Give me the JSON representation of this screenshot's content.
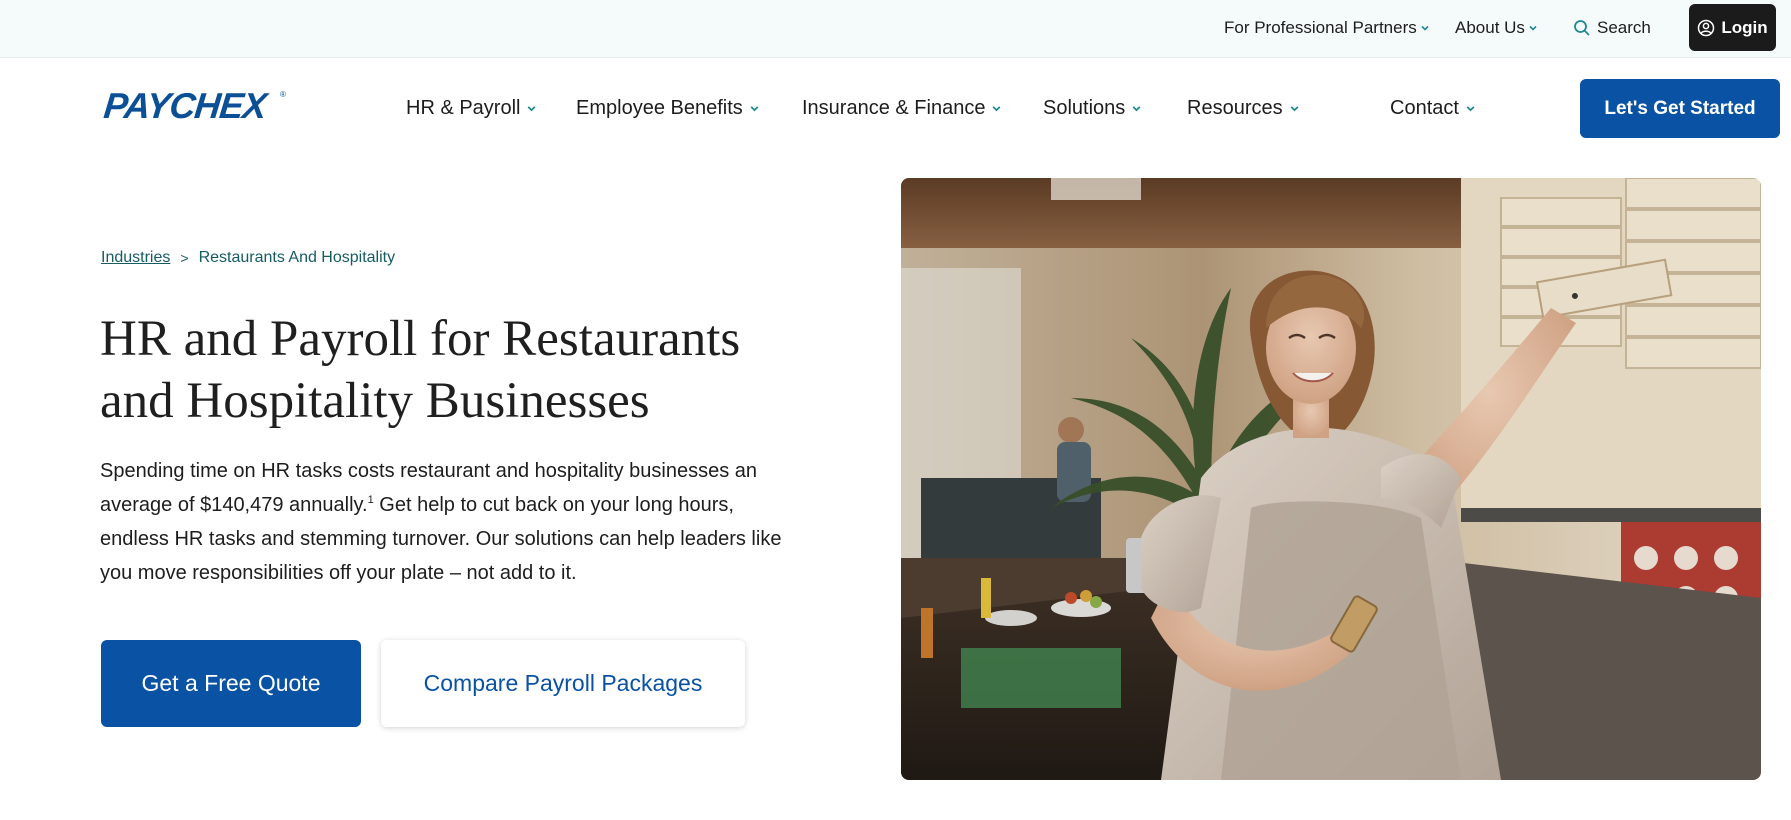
{
  "utility_bar": {
    "partners_label": "For Professional Partners",
    "about_label": "About Us",
    "search_label": "Search",
    "login_label": "Login"
  },
  "brand": {
    "logo_text": "PAYCHEX",
    "logo_mark": "®",
    "primary_color": "#0a52a3",
    "accent_color": "#1d8a93"
  },
  "nav": {
    "items": [
      {
        "label": "HR & Payroll"
      },
      {
        "label": "Employee Benefits"
      },
      {
        "label": "Insurance & Finance"
      },
      {
        "label": "Solutions"
      },
      {
        "label": "Resources"
      },
      {
        "label": "Contact"
      }
    ],
    "cta_label": "Let's Get Started"
  },
  "breadcrumb": {
    "parent": "Industries",
    "separator": ">",
    "current": "Restaurants And Hospitality"
  },
  "hero": {
    "title": "HR and Payroll for Restaurants and Hospitality Businesses",
    "body_part1": "Spending time on HR tasks costs restaurant and hospitality businesses an average of $140,479 annually.",
    "footnote": "1",
    "body_part2": " Get help to cut back on your long hours, endless HR tasks and stemming turnover. Our solutions can help leaders like you move responsibilities off your plate – not add to it.",
    "primary_button": "Get a Free Quote",
    "secondary_button": "Compare Payroll Packages"
  },
  "icons": {
    "chevron": "chevron-down-icon",
    "search": "search-icon",
    "user": "user-circle-icon"
  }
}
